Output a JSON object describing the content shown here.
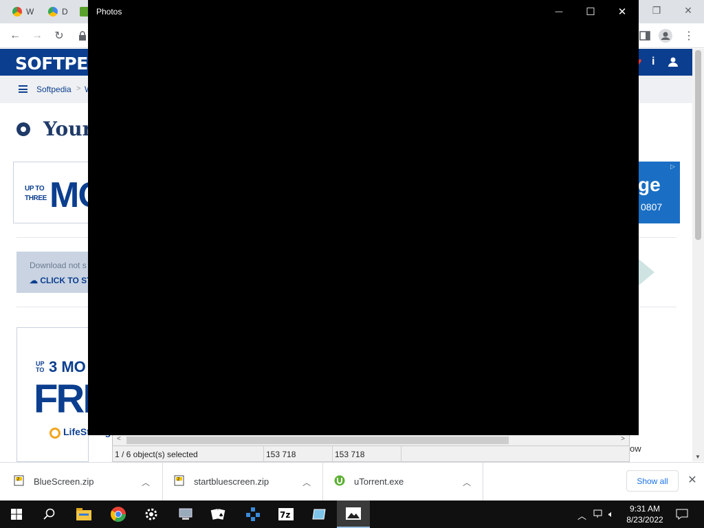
{
  "browser": {
    "tabs": [
      {
        "label": "W",
        "icon": "chrome-icon"
      },
      {
        "label": "D",
        "icon": "google-drive-icon"
      }
    ],
    "window_controls": {
      "restore": "❐",
      "close": "✕"
    }
  },
  "page": {
    "logo": "SOFTPEDIA",
    "breadcrumb": {
      "root": "Softpedia",
      "separator": ">",
      "next": "W"
    },
    "title": "Your",
    "ad_top": {
      "small": "UP TO THREE",
      "big": "MO",
      "right_big": "ge",
      "right_small": "0807"
    },
    "download_box": {
      "line1": "Download not s",
      "line2": "CLICK TO ST"
    },
    "ad_side": {
      "up_to": "UP TO",
      "three": "3 MO",
      "free": "FRE",
      "brand": "LifeStorage"
    },
    "tail_text": "ow"
  },
  "photos": {
    "title": "Photos",
    "minimize": "—",
    "maximize": "☐",
    "close": "✕"
  },
  "statusbar": {
    "selection": "1 / 6 object(s) selected",
    "size1": "153 718",
    "size2": "153 718"
  },
  "downloads": {
    "items": [
      {
        "name": "BlueScreen.zip"
      },
      {
        "name": "startbluescreen.zip"
      },
      {
        "name": "uTorrent.exe"
      }
    ],
    "show_all": "Show all"
  },
  "taskbar": {
    "apps": [
      "windows-start",
      "search",
      "file-explorer",
      "chrome",
      "settings",
      "system-tool",
      "solitaire",
      "network-app",
      "7zip",
      "notepad",
      "photos"
    ],
    "time": "9:31 AM",
    "date": "8/23/2022"
  },
  "colors": {
    "softpedia_blue": "#0b3e8e",
    "photos_bg": "#000000",
    "taskbar_bg": "#101010",
    "link_blue": "#1a73e8"
  }
}
